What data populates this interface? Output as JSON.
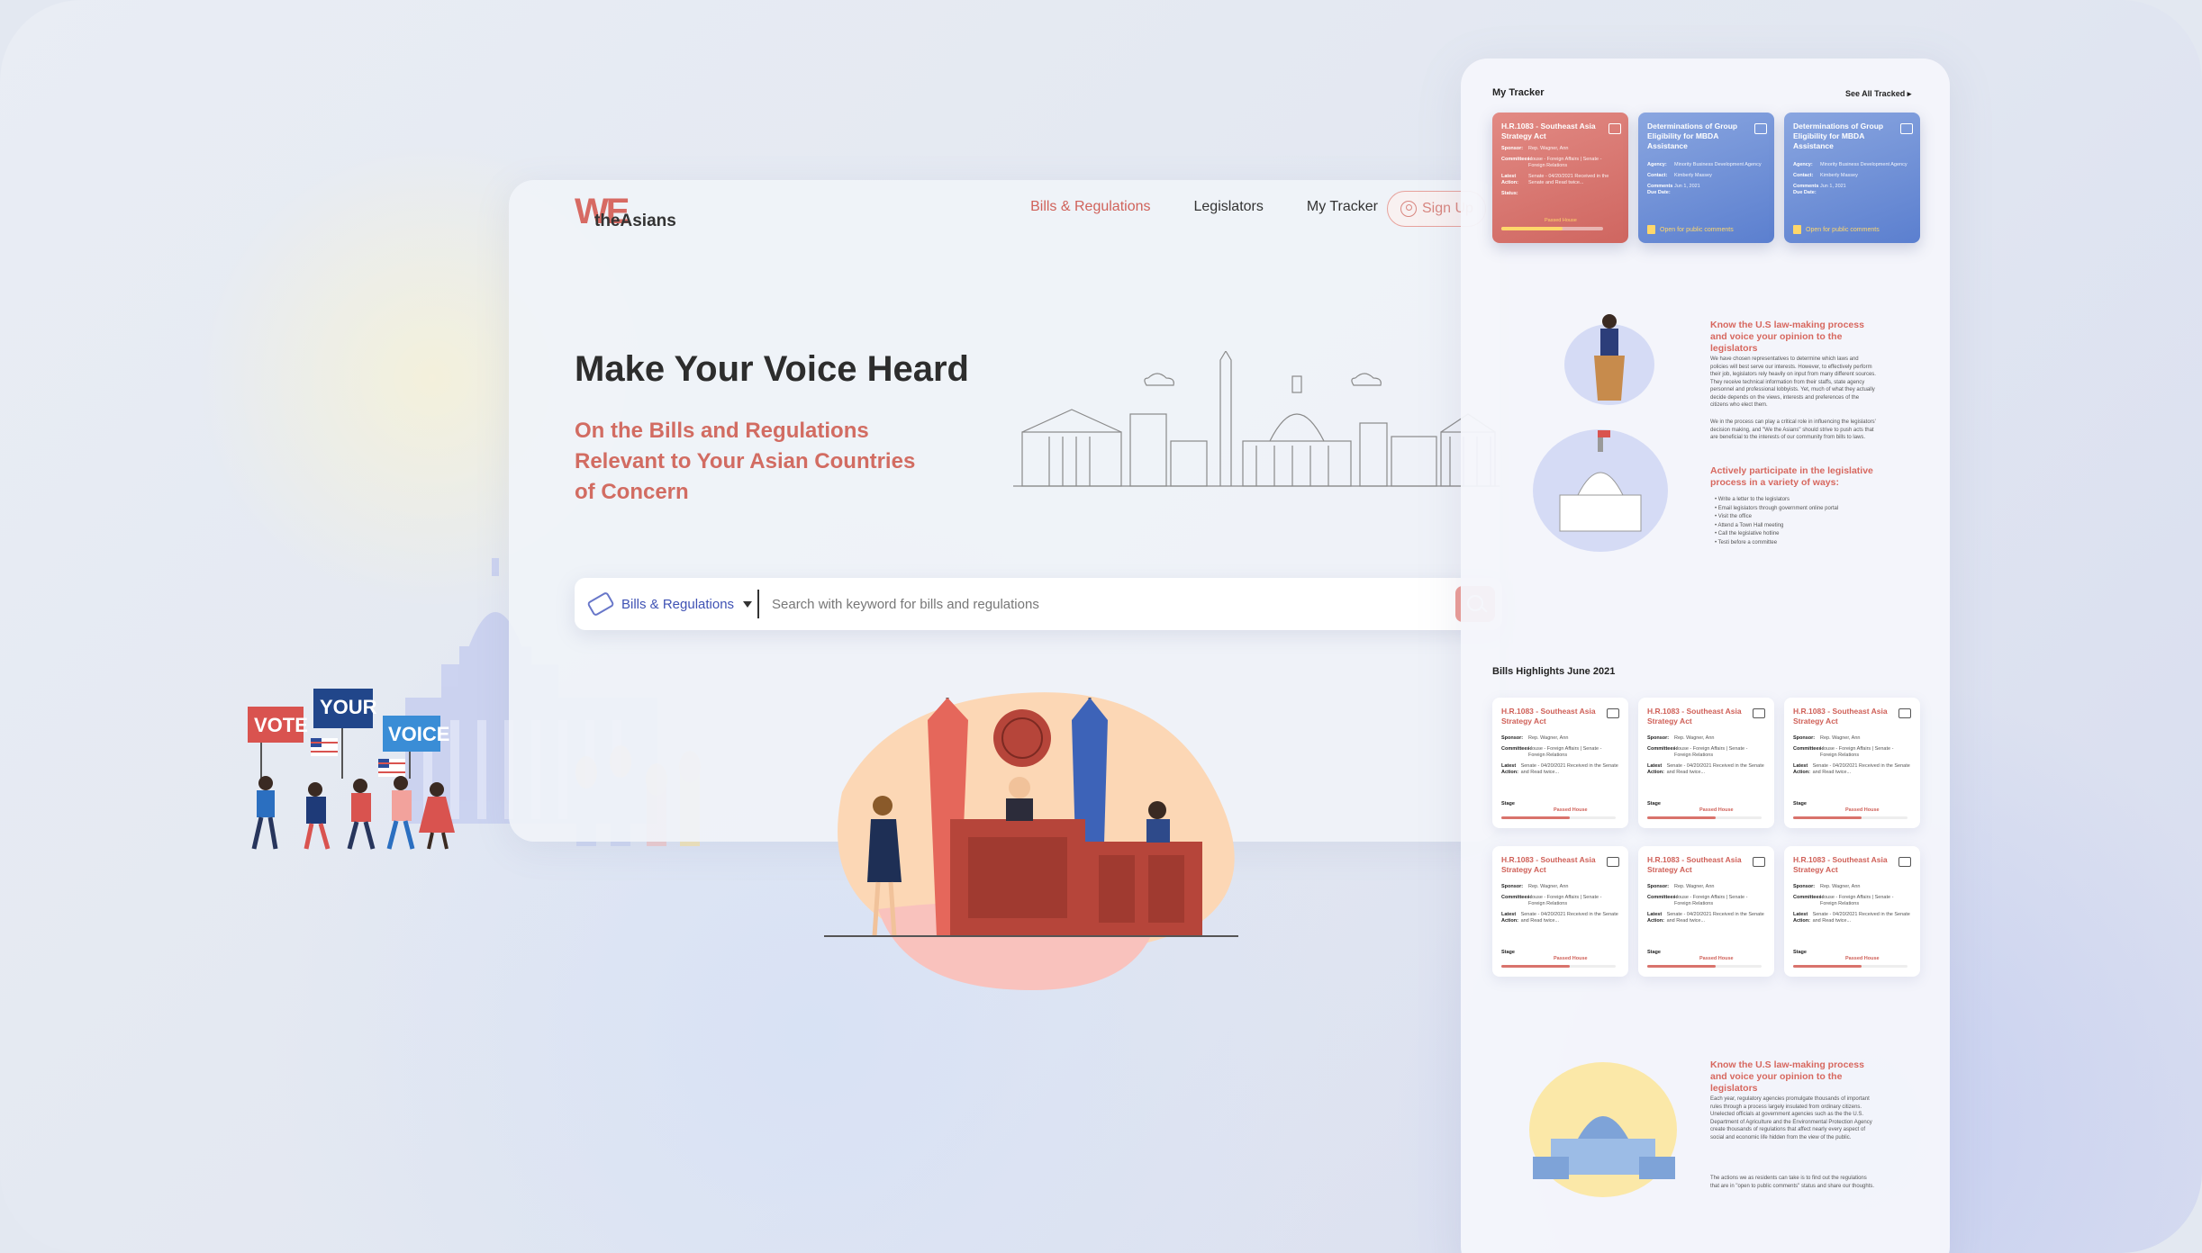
{
  "logo": {
    "we": "WE",
    "the_asians": "theAsians"
  },
  "nav": {
    "items": [
      {
        "label": "Bills & Regulations",
        "active": true
      },
      {
        "label": "Legislators",
        "active": false
      },
      {
        "label": "My Tracker",
        "active": false
      }
    ],
    "signup_label": "Sign Up"
  },
  "hero": {
    "title": "Make Your Voice Heard",
    "subtitle": "On the Bills and Regulations Relevant to Your Asian Countries of Concern"
  },
  "search": {
    "category": "Bills & Regulations",
    "placeholder": "Search with keyword for bills and regulations"
  },
  "signs": {
    "vote": "VOTE",
    "your": "YOUR",
    "voice": "VOICE"
  },
  "tracker": {
    "heading": "My Tracker",
    "see_all": "See All Tracked",
    "cards": [
      {
        "title": "H.R.1083 - Southeast Asia Strategy Act",
        "color": "#d86e67",
        "rows": [
          {
            "k": "Sponsor:",
            "v": "Rep. Wagner, Ann"
          },
          {
            "k": "Committees:",
            "v": "House - Foreign Affairs | Senate - Foreign Relations"
          },
          {
            "k": "Latest Action:",
            "v": "Senate - 04/20/2021 Received in the Senate and Read twice..."
          },
          {
            "k": "Status:",
            "v": ""
          }
        ],
        "stage": "Passed House"
      },
      {
        "title": "Determinations of Group Eligibility for MBDA Assistance",
        "color": "#6f8fd6",
        "rows": [
          {
            "k": "Agency:",
            "v": "Minority Business Development Agency"
          },
          {
            "k": "Contact:",
            "v": "Kimberly Massey"
          },
          {
            "k": "Comments Due Date:",
            "v": "Jun 1, 2021"
          }
        ],
        "open": "Open for public comments"
      },
      {
        "title": "Determinations of Group Eligibility for MBDA Assistance",
        "color": "#6f8fd6",
        "rows": [
          {
            "k": "Agency:",
            "v": "Minority Business Development Agency"
          },
          {
            "k": "Contact:",
            "v": "Kimberly Massey"
          },
          {
            "k": "Comments Due Date:",
            "v": "Jun 1, 2021"
          }
        ],
        "open": "Open for public comments"
      }
    ]
  },
  "info1": {
    "title": "Know the U.S law-making process and voice your opinion to the legislators",
    "body": "We have chosen representatives to determine which laws and policies will best serve our interests. However, to effectively perform their job, legislators rely heavily on input from many different sources. They receive technical information from their staffs, state agency personnel and professional lobbyists. Yet, much of what they actually decide depends on the views, interests and preferences of the citizens who elect them.",
    "body2": "We in the process can play a critical role in influencing the legislators' decision making, and \"We the Asians\" should strive to push acts that are beneficial to the interests of our community from bills to laws.",
    "title2": "Actively participate in the legislative process in a variety of ways:",
    "list": [
      "Write a letter to the legislators",
      "Email legislators through government online portal",
      "Visit the office",
      "Attend a Town Hall meeting",
      "Call the legislative hotline",
      "Testi before a committee"
    ]
  },
  "highlights": {
    "heading": "Bills Highlights June 2021",
    "cards": [
      {
        "title": "H.R.1083 - Southeast Asia Strategy Act",
        "sponsor": "Rep. Wagner, Ann",
        "committees": "House - Foreign Affairs | Senate - Foreign Relations",
        "action": "Senate - 04/20/2021 Received in the Senate and Read twice...",
        "stage": "Passed House"
      },
      {
        "title": "H.R.1083 - Southeast Asia Strategy Act",
        "sponsor": "Rep. Wagner, Ann",
        "committees": "House - Foreign Affairs | Senate - Foreign Relations",
        "action": "Senate - 04/20/2021 Received in the Senate and Read twice...",
        "stage": "Passed House"
      },
      {
        "title": "H.R.1083 - Southeast Asia Strategy Act",
        "sponsor": "Rep. Wagner, Ann",
        "committees": "House - Foreign Affairs | Senate - Foreign Relations",
        "action": "Senate - 04/20/2021 Received in the Senate and Read twice...",
        "stage": "Passed House"
      },
      {
        "title": "H.R.1083 - Southeast Asia Strategy Act",
        "sponsor": "Rep. Wagner, Ann",
        "committees": "House - Foreign Affairs | Senate - Foreign Relations",
        "action": "Senate - 04/20/2021 Received in the Senate and Read twice...",
        "stage": "Passed House"
      },
      {
        "title": "H.R.1083 - Southeast Asia Strategy Act",
        "sponsor": "Rep. Wagner, Ann",
        "committees": "House - Foreign Affairs | Senate - Foreign Relations",
        "action": "Senate - 04/20/2021 Received in the Senate and Read twice...",
        "stage": "Passed House"
      },
      {
        "title": "H.R.1083 - Southeast Asia Strategy Act",
        "sponsor": "Rep. Wagner, Ann",
        "committees": "House - Foreign Affairs | Senate - Foreign Relations",
        "action": "Senate - 04/20/2021 Received in the Senate and Read twice...",
        "stage": "Passed House"
      }
    ],
    "labels": {
      "sponsor": "Sponsor:",
      "committees": "Committees:",
      "action": "Latest Action:",
      "stage": "Stage"
    }
  },
  "info2": {
    "title": "Know the U.S law-making process and voice your opinion to the legislators",
    "body": "Each year, regulatory agencies promulgate thousands of important rules through a process largely insulated from ordinary citizens. Unelected officials at government agencies such as the the U.S. Department of Agriculture and the Environmental Protection Agency create thousands of regulations that affect nearly every aspect of social and economic life hidden from the view of the public.",
    "body2": "The actions we as residents can take is to find out the regulations that are in \"open to public comments\" status and share our thoughts."
  },
  "colors": {
    "accent": "#d26c62",
    "link_blue": "#3f52b4",
    "tracker_red": "#d86e67",
    "tracker_blue": "#6f8fd6"
  }
}
